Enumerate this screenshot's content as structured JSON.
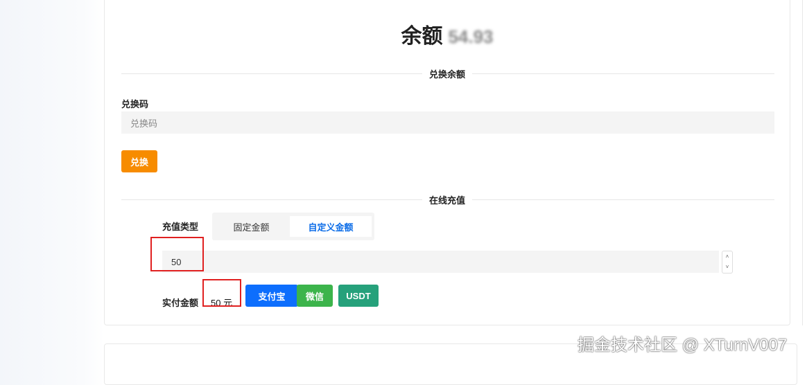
{
  "balance": {
    "title": "余额",
    "value": "54.93"
  },
  "redeem": {
    "section": "兑换余额",
    "label": "兑换码",
    "placeholder": "兑换码",
    "button": "兑换"
  },
  "recharge": {
    "section": "在线充值",
    "type_label": "充值类型",
    "tabs": [
      "固定金额",
      "自定义金额"
    ],
    "active_tab": 1,
    "amount": "50",
    "pay_label": "实付金额",
    "pay_amount": "50 元",
    "methods": [
      "支付宝",
      "微信",
      "USDT"
    ]
  },
  "colors": {
    "accent": "#0e6ee8",
    "orange": "#f78c00",
    "alipay": "#0d6efd",
    "wechat": "#3cb44b",
    "usdt": "#26a17b"
  },
  "watermark": "掘金技术社区 @ XTurnV007"
}
